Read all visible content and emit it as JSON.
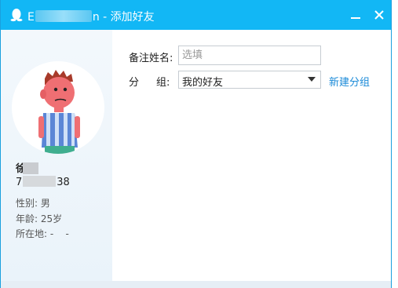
{
  "window": {
    "title_prefix": "E",
    "title_suffix": "n - 添加好友"
  },
  "profile": {
    "nickname_visible": "徐",
    "qq_prefix": "7",
    "qq_suffix": "38",
    "gender_label": "性别:",
    "gender_value": "男",
    "age_label": "年龄:",
    "age_value": "25岁",
    "location_label": "所在地:",
    "location_value": "-    -"
  },
  "form": {
    "remark_label": "备注姓名:",
    "remark_placeholder": "选填",
    "group_label_1": "分",
    "group_label_2": "组:",
    "group_value": "我的好友",
    "new_group_link": "新建分组"
  },
  "colors": {
    "titlebar": "#12b7f5",
    "link": "#1a8ad8"
  },
  "icons": {
    "title": "qq-penguin-icon",
    "minimize": "minimize-icon",
    "close": "close-icon",
    "dropdown": "chevron-down-icon"
  }
}
